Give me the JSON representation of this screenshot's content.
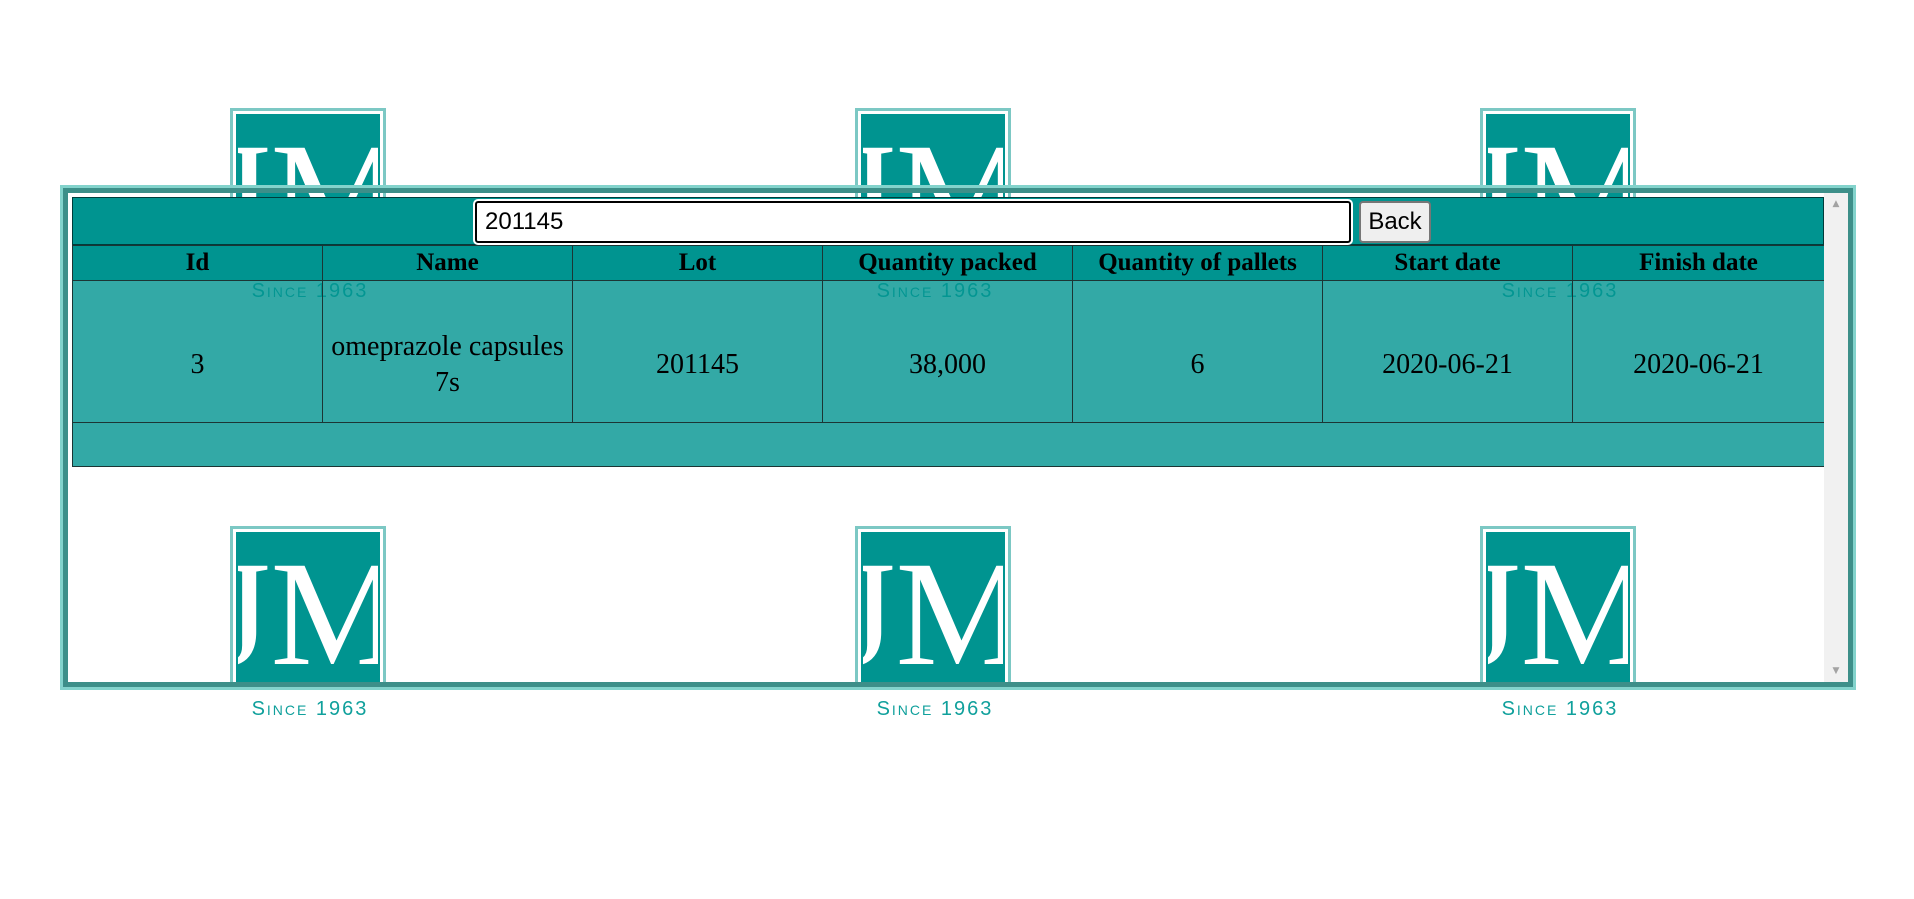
{
  "logo": {
    "letters": "JM",
    "tagline": "Since 1963"
  },
  "search": {
    "value": "201145"
  },
  "toolbar": {
    "back_label": "Back"
  },
  "table": {
    "columns": [
      "Id",
      "Name",
      "Lot",
      "Quantity packed",
      "Quantity of pallets",
      "Start date",
      "Finish date"
    ],
    "rows": [
      {
        "id": "3",
        "name": "omeprazole capsules 7s",
        "lot": "201145",
        "quantity_packed": "38,000",
        "quantity_pallets": "6",
        "start_date": "2020-06-21",
        "finish_date": "2020-06-21"
      }
    ]
  },
  "colors": {
    "brand_teal": "#009490",
    "panel_border": "#3d8f89"
  }
}
